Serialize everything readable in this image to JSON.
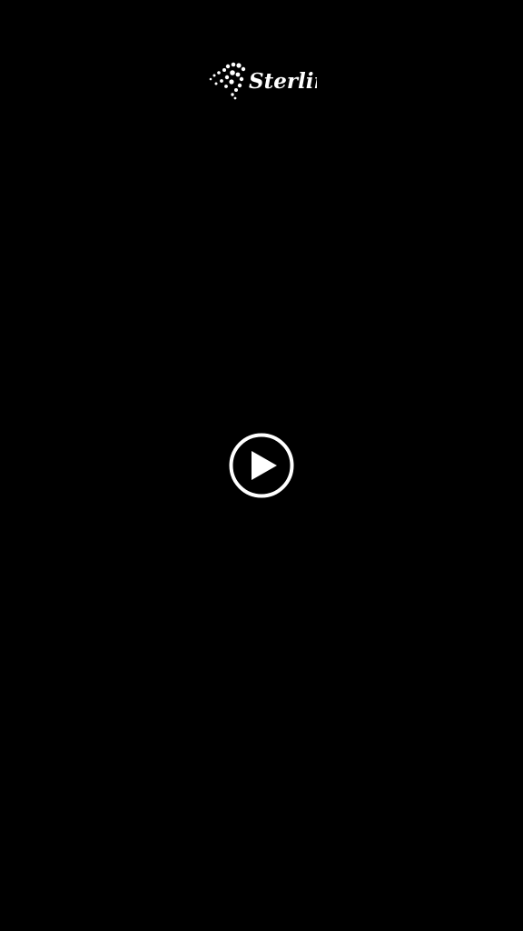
{
  "brand": {
    "name": "Sterling",
    "icon": "dotted-swirl-logo-icon"
  },
  "player": {
    "play_icon": "play-circle-icon"
  },
  "colors": {
    "background": "#000000",
    "foreground": "#ffffff"
  }
}
